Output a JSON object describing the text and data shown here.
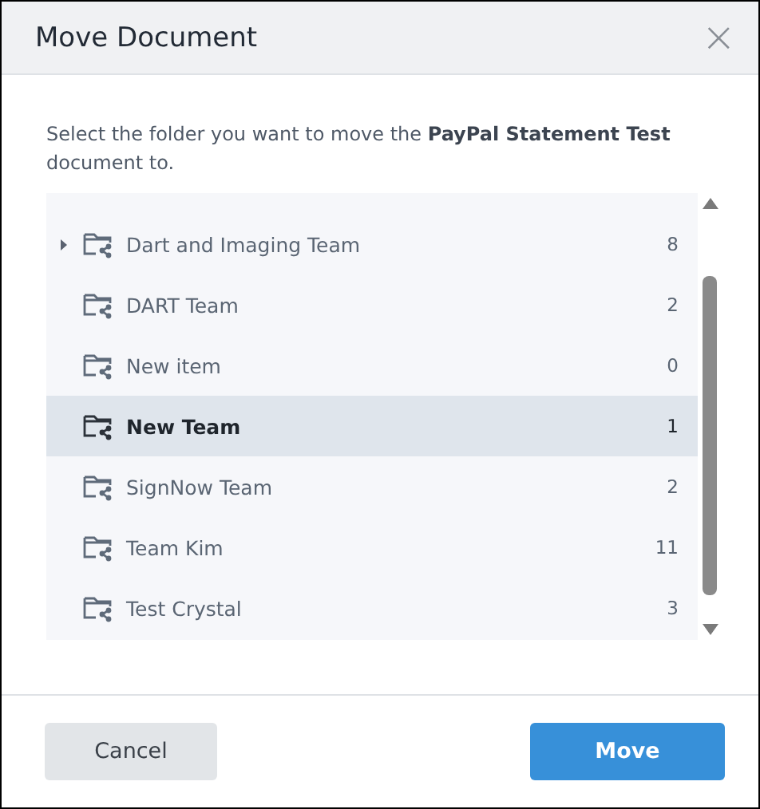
{
  "dialog": {
    "title": "Move Document",
    "close": "×"
  },
  "instruction": "Select the folder you want to move the **PayPal Statement Test** document to.",
  "folders": [
    {
      "name": "Dart and Imaging Team",
      "count": "8",
      "expandable": true,
      "selected": false
    },
    {
      "name": "DART Team",
      "count": "2",
      "expandable": false,
      "selected": false
    },
    {
      "name": "New item",
      "count": "0",
      "expandable": false,
      "selected": false
    },
    {
      "name": "New Team",
      "count": "1",
      "expandable": false,
      "selected": true
    },
    {
      "name": "SignNow Team",
      "count": "2",
      "expandable": false,
      "selected": false
    },
    {
      "name": "Team Kim",
      "count": "11",
      "expandable": false,
      "selected": false
    },
    {
      "name": "Test Crystal",
      "count": "3",
      "expandable": false,
      "selected": false
    }
  ],
  "buttons": [
    {
      "label": "Cancel",
      "kind": "secondary"
    },
    {
      "label": "Move",
      "kind": "primary"
    }
  ]
}
